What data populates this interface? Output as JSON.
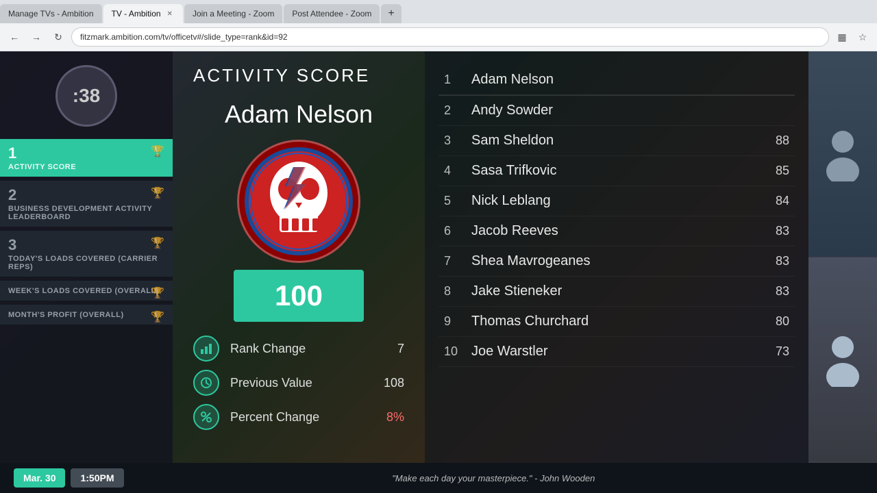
{
  "browser": {
    "tabs": [
      {
        "label": "Manage TVs - Ambition",
        "active": false,
        "closable": false
      },
      {
        "label": "TV - Ambition",
        "active": true,
        "closable": true
      },
      {
        "label": "Join a Meeting - Zoom",
        "active": false,
        "closable": false
      },
      {
        "label": "Post Attendee - Zoom",
        "active": false,
        "closable": false
      }
    ],
    "url": "fitzmark.ambition.com/tv/officetv#/slide_type=rank&id=92",
    "new_tab_label": "+"
  },
  "timer": {
    "display": ":38"
  },
  "sidebar": {
    "items": [
      {
        "num": "1",
        "label": "Activity Score",
        "active": true
      },
      {
        "num": "2",
        "label": "Business Development Activity Leaderboard",
        "active": false
      },
      {
        "num": "3",
        "label": "Today's Loads Covered (Carrier Reps)",
        "active": false
      },
      {
        "num": "",
        "label": "Week's Loads Covered (Overall)",
        "active": false
      },
      {
        "num": "",
        "label": "Month's Profit (Overall)",
        "active": false
      }
    ]
  },
  "main": {
    "title": "Activity Score",
    "winner": {
      "name": "Adam Nelson",
      "score": "100"
    },
    "stats": [
      {
        "icon": "chart-icon",
        "label": "Rank Change",
        "value": "7",
        "highlight": false
      },
      {
        "icon": "clock-icon",
        "label": "Previous Value",
        "value": "108",
        "highlight": false
      },
      {
        "icon": "percent-icon",
        "label": "Percent Change",
        "value": "8%",
        "highlight": true
      }
    ]
  },
  "leaderboard": {
    "rows": [
      {
        "rank": "1",
        "name": "Adam Nelson",
        "score": ""
      },
      {
        "rank": "2",
        "name": "Andy Sowder",
        "score": ""
      },
      {
        "rank": "3",
        "name": "Sam Sheldon",
        "score": "88"
      },
      {
        "rank": "4",
        "name": "Sasa Trifkovic",
        "score": "85"
      },
      {
        "rank": "5",
        "name": "Nick Leblang",
        "score": "84"
      },
      {
        "rank": "6",
        "name": "Jacob Reeves",
        "score": "83"
      },
      {
        "rank": "7",
        "name": "Shea Mavrogeanes",
        "score": "83"
      },
      {
        "rank": "8",
        "name": "Jake Stieneker",
        "score": "83"
      },
      {
        "rank": "9",
        "name": "Thomas Churchard",
        "score": "80"
      },
      {
        "rank": "10",
        "name": "Joe Warstler",
        "score": "73"
      }
    ]
  },
  "bottom": {
    "date": "Mar. 30",
    "time": "1:50PM",
    "quote": "\"Make each day your masterpiece.\" - John Wooden"
  }
}
